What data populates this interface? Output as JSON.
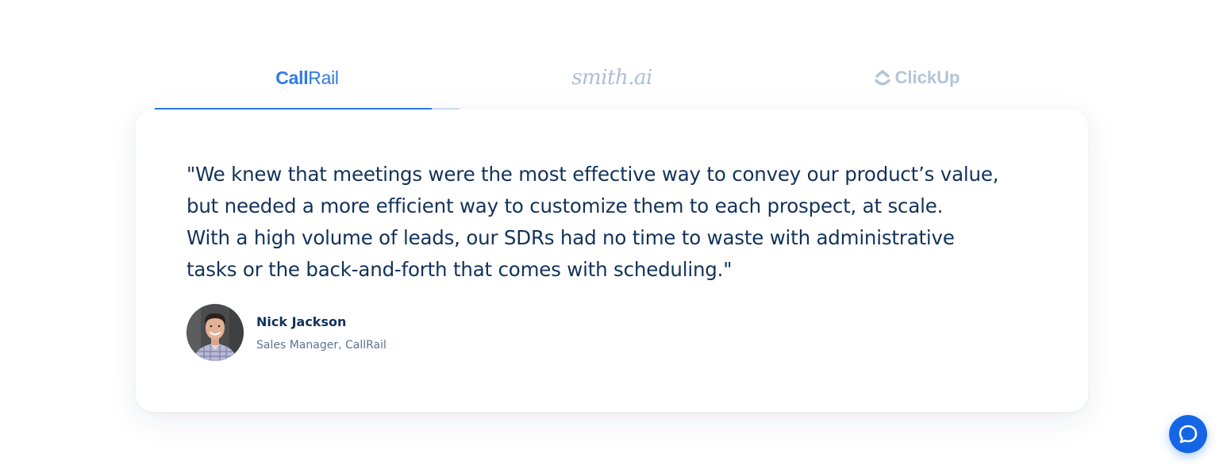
{
  "tabs": [
    {
      "logo_parts": [
        "Call",
        "Rail"
      ],
      "logo_name": "callrail-logo",
      "selected": true
    },
    {
      "logo_text": "smith.ai",
      "logo_name": "smith-ai-logo",
      "selected": false
    },
    {
      "logo_text": "ClickUp",
      "logo_name": "clickup-logo",
      "selected": false
    }
  ],
  "autoplay_progress": 0.91,
  "testimonial": {
    "quote_lines": [
      "\"We knew that meetings were the most effective way to convey our product’s value,",
      "but needed a more efficient way to customize them to each prospect, at scale.",
      "With a high volume of leads, our SDRs had no time to waste with administrative",
      "tasks or the back-and-forth that comes with scheduling.\""
    ],
    "author_name": "Nick Jackson",
    "author_role": "Sales Manager, CallRail"
  },
  "chat_launcher": {
    "icon": "chat-bubble-icon"
  },
  "colors": {
    "accent": "#2f7ae5",
    "text_primary": "#12325a",
    "text_secondary": "#5c7392",
    "logo_inactive": "#b4c4d8",
    "chat_button": "#1466e6"
  }
}
